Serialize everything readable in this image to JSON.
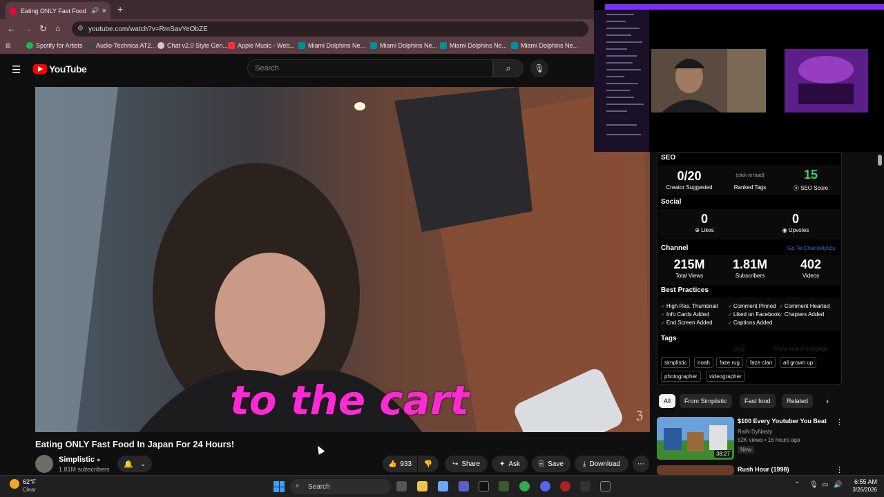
{
  "browser": {
    "tab_title": "Eating ONLY Fast Food In Ja",
    "url": "youtube.com/watch?v=RmSavYeObZE",
    "bookmarks": [
      {
        "label": "Spotify for Artists",
        "color": "#1db954"
      },
      {
        "label": "Audio-Technica AT2...",
        "color": "#444444"
      },
      {
        "label": "Chat v2.0 Style Gen...",
        "color": "#cccccc"
      },
      {
        "label": "Apple Music - Web...",
        "color": "#fa2d48"
      },
      {
        "label": "Miami Dolphins Ne...",
        "color": "#008e97"
      },
      {
        "label": "Miami Dolphins Ne...",
        "color": "#008e97"
      },
      {
        "label": "Miami Dolphins Ne...",
        "color": "#008e97"
      },
      {
        "label": "Miami Dolphins Ne...",
        "color": "#008e97"
      }
    ]
  },
  "youtube": {
    "logo_text": "YouTube",
    "search_placeholder": "Search",
    "video_caption": "to the cart",
    "title": "Eating ONLY Fast Food In Japan For 24 Hours!",
    "channel_name": "Simplistic",
    "channel_subs": "1.81M subscribers",
    "likes": "933",
    "share": "Share",
    "ask": "Ask",
    "save": "Save",
    "download": "Download"
  },
  "seo_panel": {
    "seo_header": "SEO",
    "creator_suggested_value": "0/20",
    "creator_suggested_label": "Creator Suggested",
    "ranked_tags_hint": "(click to load)",
    "ranked_tags_label": "Ranked Tags",
    "seo_score_value": "15",
    "seo_score_label": "SEO Score",
    "social_header": "Social",
    "likes_value": "0",
    "likes_label": "Likes",
    "upvotes_value": "0",
    "upvotes_label": "Upvotes",
    "channel_header": "Channel",
    "channel_link": "Go To Channelytics",
    "total_views_value": "215M",
    "total_views_label": "Total Views",
    "subscribers_value": "1.81M",
    "subscribers_label": "Subscribers",
    "videos_value": "402",
    "videos_label": "Videos",
    "best_practices_header": "Best Practices",
    "best_practices": [
      "High Res. Thumbnail",
      "Comment Pinned",
      "Comment Hearted",
      "Info Cards Added",
      "Liked on Facebook",
      "Chapters Added",
      "End Screen Added",
      "Captions Added"
    ],
    "tags_header": "Tags",
    "tags_copy": "copy",
    "tags_show_rankings": "Show search rankings",
    "tags": [
      "simplistic",
      "noah",
      "faze rug",
      "faze clan",
      "all grown up",
      "photographer",
      "videographer"
    ]
  },
  "chips": [
    "All",
    "From Simplistic",
    "Fast food",
    "Related"
  ],
  "recommendations": [
    {
      "title": "$100 Every Youtuber You Beat",
      "channel": "RaiN DyNasty",
      "meta": "52K views • 16 hours ago",
      "badge": "New",
      "duration": "38:27"
    },
    {
      "title": "Rush Hour (1998)"
    }
  ],
  "taskbar": {
    "temperature": "62°F",
    "condition": "Clear",
    "search": "Search",
    "time": "6:55 AM",
    "date": "3/26/2026"
  },
  "colors": {
    "accent_red": "#ff0000",
    "caption_magenta": "#ff2ad4",
    "seo_score_green": "#3ecf6b",
    "channelytics_blue": "#3e6bd6"
  }
}
